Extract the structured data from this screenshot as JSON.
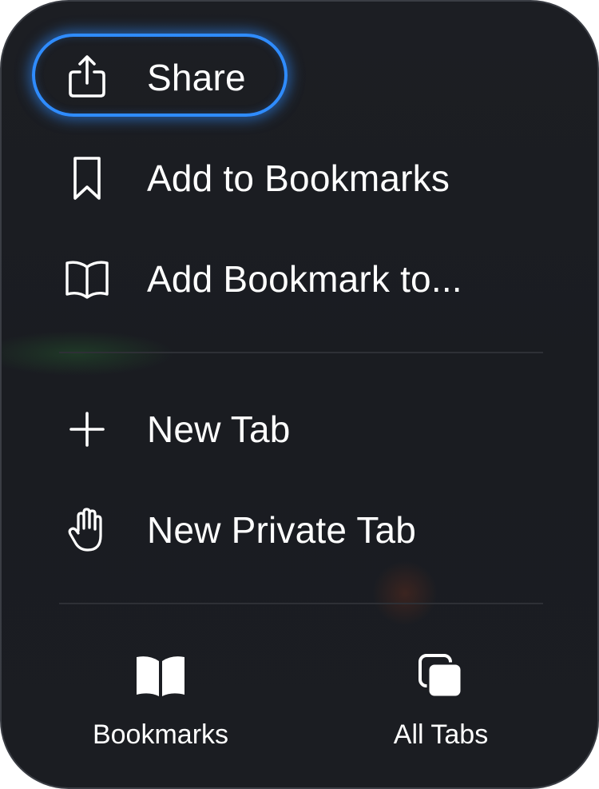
{
  "menu": {
    "items": [
      {
        "label": "Share",
        "icon": "share-icon"
      },
      {
        "label": "Add to Bookmarks",
        "icon": "bookmark-icon"
      },
      {
        "label": "Add Bookmark to...",
        "icon": "open-book-icon"
      },
      {
        "label": "New Tab",
        "icon": "plus-icon"
      },
      {
        "label": "New Private Tab",
        "icon": "hand-icon"
      }
    ],
    "bottom": [
      {
        "label": "Bookmarks",
        "icon": "bookmarks-book-icon"
      },
      {
        "label": "All Tabs",
        "icon": "tabs-stack-icon"
      }
    ]
  },
  "colors": {
    "focus_ring": "#2f8cff",
    "background": "#1b1d22",
    "text": "#ffffff",
    "divider": "#2e3036"
  }
}
